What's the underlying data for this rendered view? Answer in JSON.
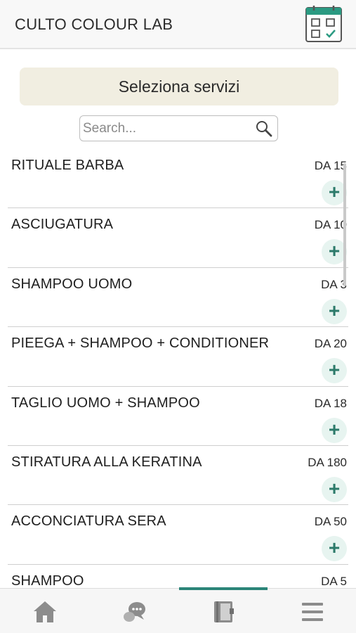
{
  "header": {
    "title": "CULTO COLOUR LAB",
    "calendar_icon": "calendar-check-icon"
  },
  "select_services_label": "Seleziona servizi",
  "search": {
    "placeholder": "Search...",
    "value": ""
  },
  "services": [
    {
      "name": "RITUALE BARBA",
      "price": "DA 15"
    },
    {
      "name": "ASCIUGATURA",
      "price": "DA 10"
    },
    {
      "name": "SHAMPOO UOMO",
      "price": "DA 3"
    },
    {
      "name": "PIEEGA + SHAMPOO + CONDITIONER",
      "price": "DA 20"
    },
    {
      "name": "TAGLIO UOMO + SHAMPOO",
      "price": "DA 18"
    },
    {
      "name": "STIRATURA ALLA KERATINA",
      "price": "DA 180"
    },
    {
      "name": "ACCONCIATURA SERA",
      "price": "DA 50"
    },
    {
      "name": "SHAMPOO",
      "price": "DA 5"
    }
  ],
  "add_symbol": "+",
  "tabbar": {
    "active_index": 2,
    "accent_color": "#2b8578",
    "tabs": [
      {
        "icon": "home-icon"
      },
      {
        "icon": "chat-icon"
      },
      {
        "icon": "book-icon"
      },
      {
        "icon": "menu-icon"
      }
    ]
  },
  "colors": {
    "accent": "#2b8578",
    "button_bg": "#f1eee1",
    "add_bg": "#e7f4f0"
  }
}
